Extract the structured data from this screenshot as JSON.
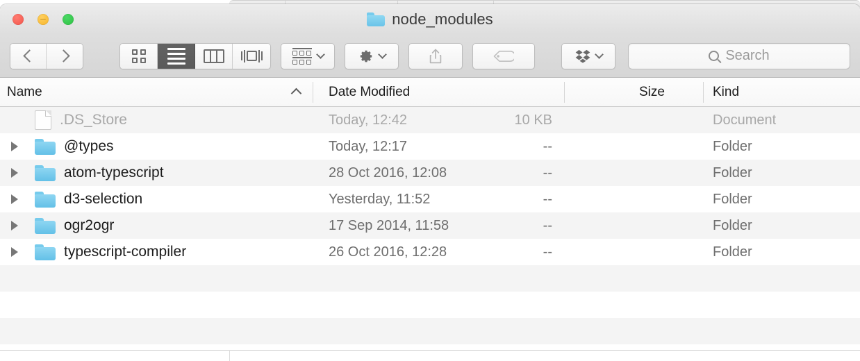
{
  "window": {
    "title": "node_modules",
    "title_icon": "folder-icon",
    "traffic_lights": [
      {
        "name": "close-button",
        "color": "#f2544a"
      },
      {
        "name": "minimize-button",
        "color": "#f6b429"
      },
      {
        "name": "maximize-button",
        "color": "#2ec143"
      }
    ]
  },
  "toolbar": {
    "back_label": "Back",
    "forward_label": "Forward",
    "view_modes": [
      {
        "name": "icon-view",
        "icon": "grid-icon",
        "selected": false
      },
      {
        "name": "list-view",
        "icon": "list-icon",
        "selected": true
      },
      {
        "name": "column-view",
        "icon": "columns-icon",
        "selected": false
      },
      {
        "name": "gallery-view",
        "icon": "coverflow-icon",
        "selected": false
      }
    ],
    "arrange_label": "Arrange",
    "arrange_icon": "arrange-icon",
    "action_label": "Action",
    "action_icon": "gear-icon",
    "share_label": "Share",
    "share_icon": "share-icon",
    "tags_label": "Tags",
    "tags_icon": "tag-icon",
    "dropbox_label": "Dropbox",
    "dropbox_icon": "dropbox-icon",
    "chevron_icon": "chevron-down-icon"
  },
  "search": {
    "placeholder": "Search",
    "value": "",
    "icon": "search-icon"
  },
  "columns": [
    {
      "key": "name",
      "label": "Name",
      "sorted": true,
      "sort_direction": "ascending",
      "sort_icon": "chevron-up-icon"
    },
    {
      "key": "date",
      "label": "Date Modified"
    },
    {
      "key": "size",
      "label": "Size"
    },
    {
      "key": "kind",
      "label": "Kind"
    }
  ],
  "files": [
    {
      "name": ".DS_Store",
      "date": "Today, 12:42",
      "size": "10 KB",
      "kind": "Document",
      "icon": "document-icon",
      "expandable": false,
      "dimmed": true
    },
    {
      "name": "@types",
      "date": "Today, 12:17",
      "size": "--",
      "kind": "Folder",
      "icon": "folder-icon",
      "expandable": true,
      "dimmed": false
    },
    {
      "name": "atom-typescript",
      "date": "28 Oct 2016, 12:08",
      "size": "--",
      "kind": "Folder",
      "icon": "folder-icon",
      "expandable": true,
      "dimmed": false
    },
    {
      "name": "d3-selection",
      "date": "Yesterday, 11:52",
      "size": "--",
      "kind": "Folder",
      "icon": "folder-icon",
      "expandable": true,
      "dimmed": false
    },
    {
      "name": "ogr2ogr",
      "date": "17 Sep 2014, 11:58",
      "size": "--",
      "kind": "Folder",
      "icon": "folder-icon",
      "expandable": true,
      "dimmed": false
    },
    {
      "name": "typescript-compiler",
      "date": "26 Oct 2016, 12:28",
      "size": "--",
      "kind": "Folder",
      "icon": "folder-icon",
      "expandable": true,
      "dimmed": false
    }
  ],
  "colors": {
    "folder_blue": "#76cbec",
    "selected_view_button": "#5a5a5a",
    "dimmed_text": "#a8a8a8",
    "secondary_text": "#6e6e6e",
    "primary_text": "#1d1d1d",
    "alt_row": "#f4f4f4"
  }
}
